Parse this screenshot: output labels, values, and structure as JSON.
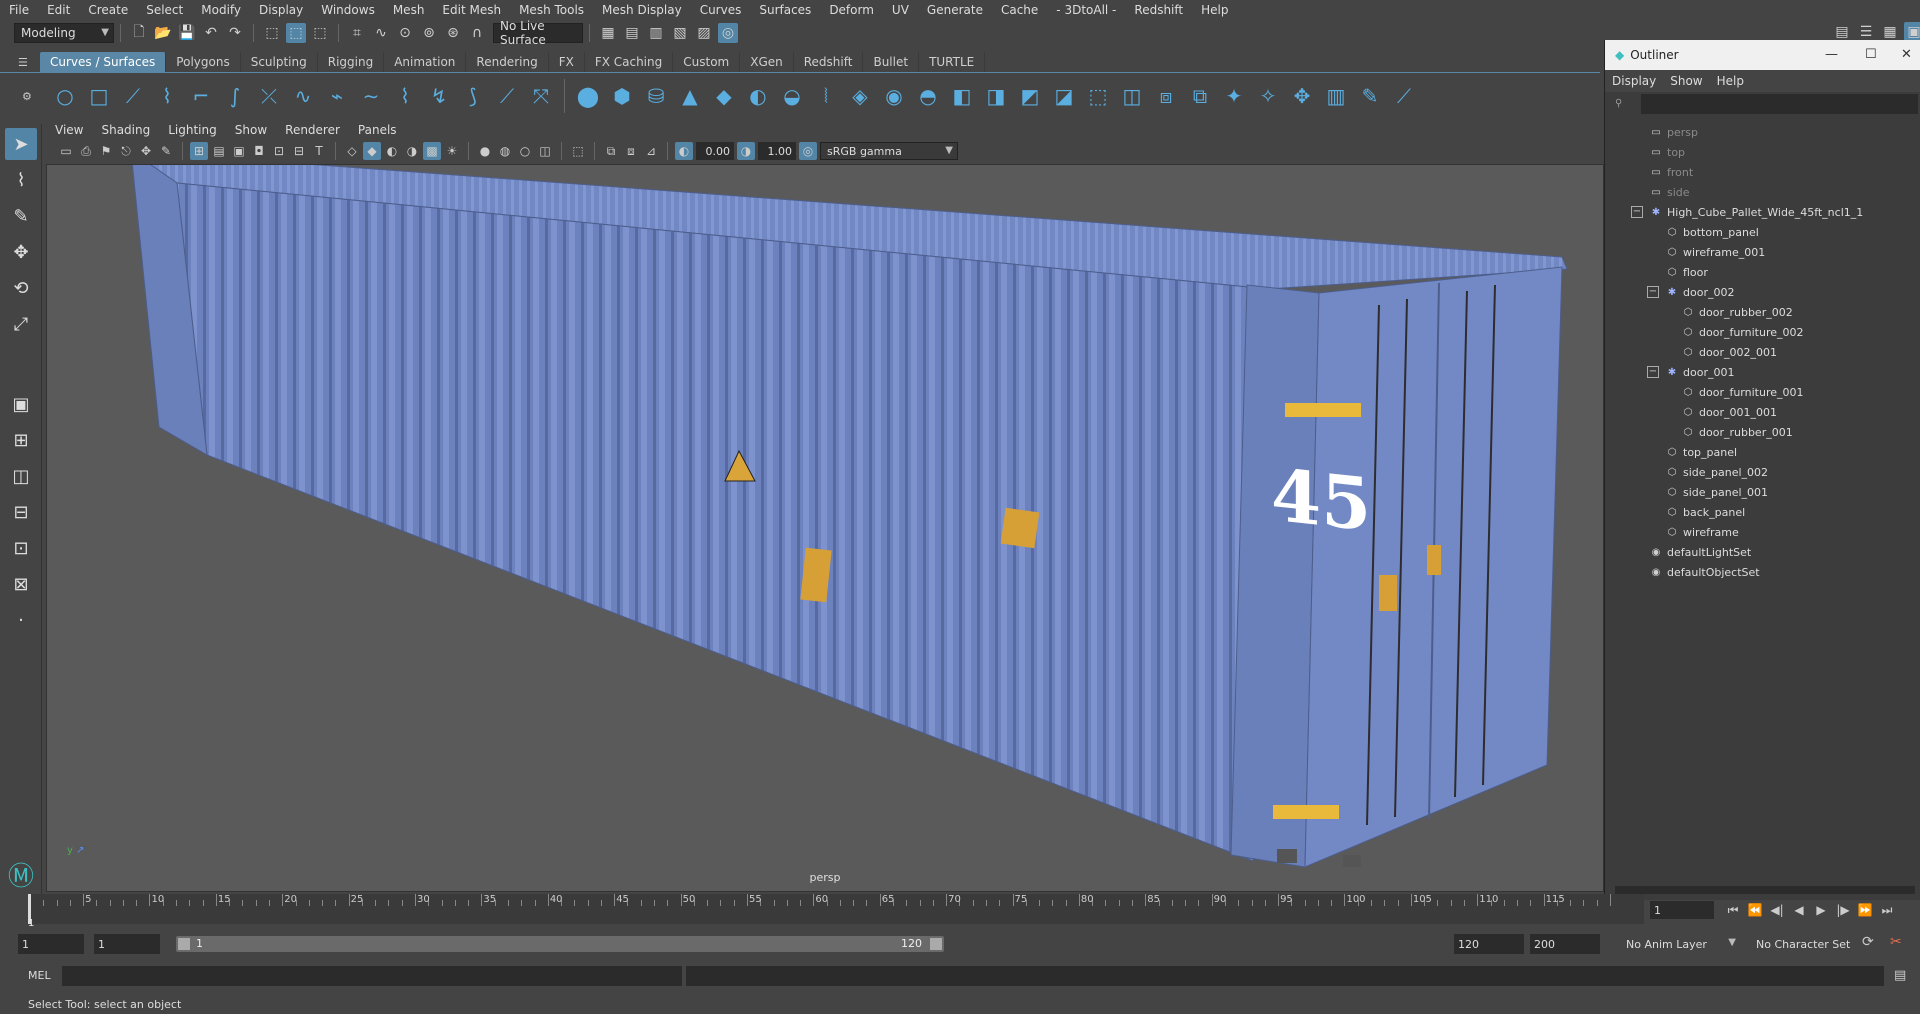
{
  "menubar": [
    "File",
    "Edit",
    "Create",
    "Select",
    "Modify",
    "Display",
    "Windows",
    "Mesh",
    "Edit Mesh",
    "Mesh Tools",
    "Mesh Display",
    "Curves",
    "Surfaces",
    "Deform",
    "UV",
    "Generate",
    "Cache",
    "- 3DtoAll -",
    "Redshift",
    "Help"
  ],
  "status": {
    "mode": "Modeling",
    "live_surface": "No Live Surface"
  },
  "shelf_tabs": [
    "Curves / Surfaces",
    "Polygons",
    "Sculpting",
    "Rigging",
    "Animation",
    "Rendering",
    "FX",
    "FX Caching",
    "Custom",
    "XGen",
    "Redshift",
    "Bullet",
    "TURTLE"
  ],
  "shelf_active": "Curves / Surfaces",
  "viewport": {
    "menus": [
      "View",
      "Shading",
      "Lighting",
      "Show",
      "Renderer",
      "Panels"
    ],
    "exposure": "0.00",
    "gamma": "1.00",
    "color_space": "sRGB gamma",
    "camera_label": "persp",
    "container_number": "45"
  },
  "outliner": {
    "title": "Outliner",
    "menus": [
      "Display",
      "Show",
      "Help"
    ],
    "items": [
      {
        "label": "persp",
        "depth": 0,
        "type": "camera",
        "dim": true
      },
      {
        "label": "top",
        "depth": 0,
        "type": "camera",
        "dim": true
      },
      {
        "label": "front",
        "depth": 0,
        "type": "camera",
        "dim": true
      },
      {
        "label": "side",
        "depth": 0,
        "type": "camera",
        "dim": true
      },
      {
        "label": "High_Cube_Pallet_Wide_45ft_ncl1_1",
        "depth": 0,
        "type": "group",
        "expanded": true
      },
      {
        "label": "bottom_panel",
        "depth": 1,
        "type": "mesh"
      },
      {
        "label": "wireframe_001",
        "depth": 1,
        "type": "mesh"
      },
      {
        "label": "floor",
        "depth": 1,
        "type": "mesh"
      },
      {
        "label": "door_002",
        "depth": 1,
        "type": "group",
        "expanded": true
      },
      {
        "label": "door_rubber_002",
        "depth": 2,
        "type": "mesh"
      },
      {
        "label": "door_furniture_002",
        "depth": 2,
        "type": "mesh"
      },
      {
        "label": "door_002_001",
        "depth": 2,
        "type": "mesh"
      },
      {
        "label": "door_001",
        "depth": 1,
        "type": "group",
        "expanded": true
      },
      {
        "label": "door_furniture_001",
        "depth": 2,
        "type": "mesh"
      },
      {
        "label": "door_001_001",
        "depth": 2,
        "type": "mesh"
      },
      {
        "label": "door_rubber_001",
        "depth": 2,
        "type": "mesh"
      },
      {
        "label": "top_panel",
        "depth": 1,
        "type": "mesh"
      },
      {
        "label": "side_panel_002",
        "depth": 1,
        "type": "mesh"
      },
      {
        "label": "side_panel_001",
        "depth": 1,
        "type": "mesh"
      },
      {
        "label": "back_panel",
        "depth": 1,
        "type": "mesh"
      },
      {
        "label": "wireframe",
        "depth": 1,
        "type": "mesh"
      },
      {
        "label": "defaultLightSet",
        "depth": 0,
        "type": "set"
      },
      {
        "label": "defaultObjectSet",
        "depth": 0,
        "type": "set"
      }
    ]
  },
  "timeline": {
    "ticks": [
      "5",
      "10",
      "15",
      "20",
      "25",
      "30",
      "35",
      "40",
      "45",
      "50",
      "55",
      "60",
      "65",
      "70",
      "75",
      "80",
      "85",
      "90",
      "95",
      "100",
      "105",
      "110",
      "115"
    ],
    "start_label": "1",
    "current_frame": "1"
  },
  "range": {
    "start": "1",
    "playback_start": "1",
    "slider_start": "1",
    "slider_end": "120",
    "playback_end": "120",
    "end": "200",
    "anim_layer": "No Anim Layer",
    "char_set": "No Character Set"
  },
  "cmdline": {
    "label": "MEL"
  },
  "helpline": "Select Tool: select an object",
  "colors": {
    "accent": "#5285a6",
    "container": "#6f86c2",
    "bg": "#444444"
  }
}
